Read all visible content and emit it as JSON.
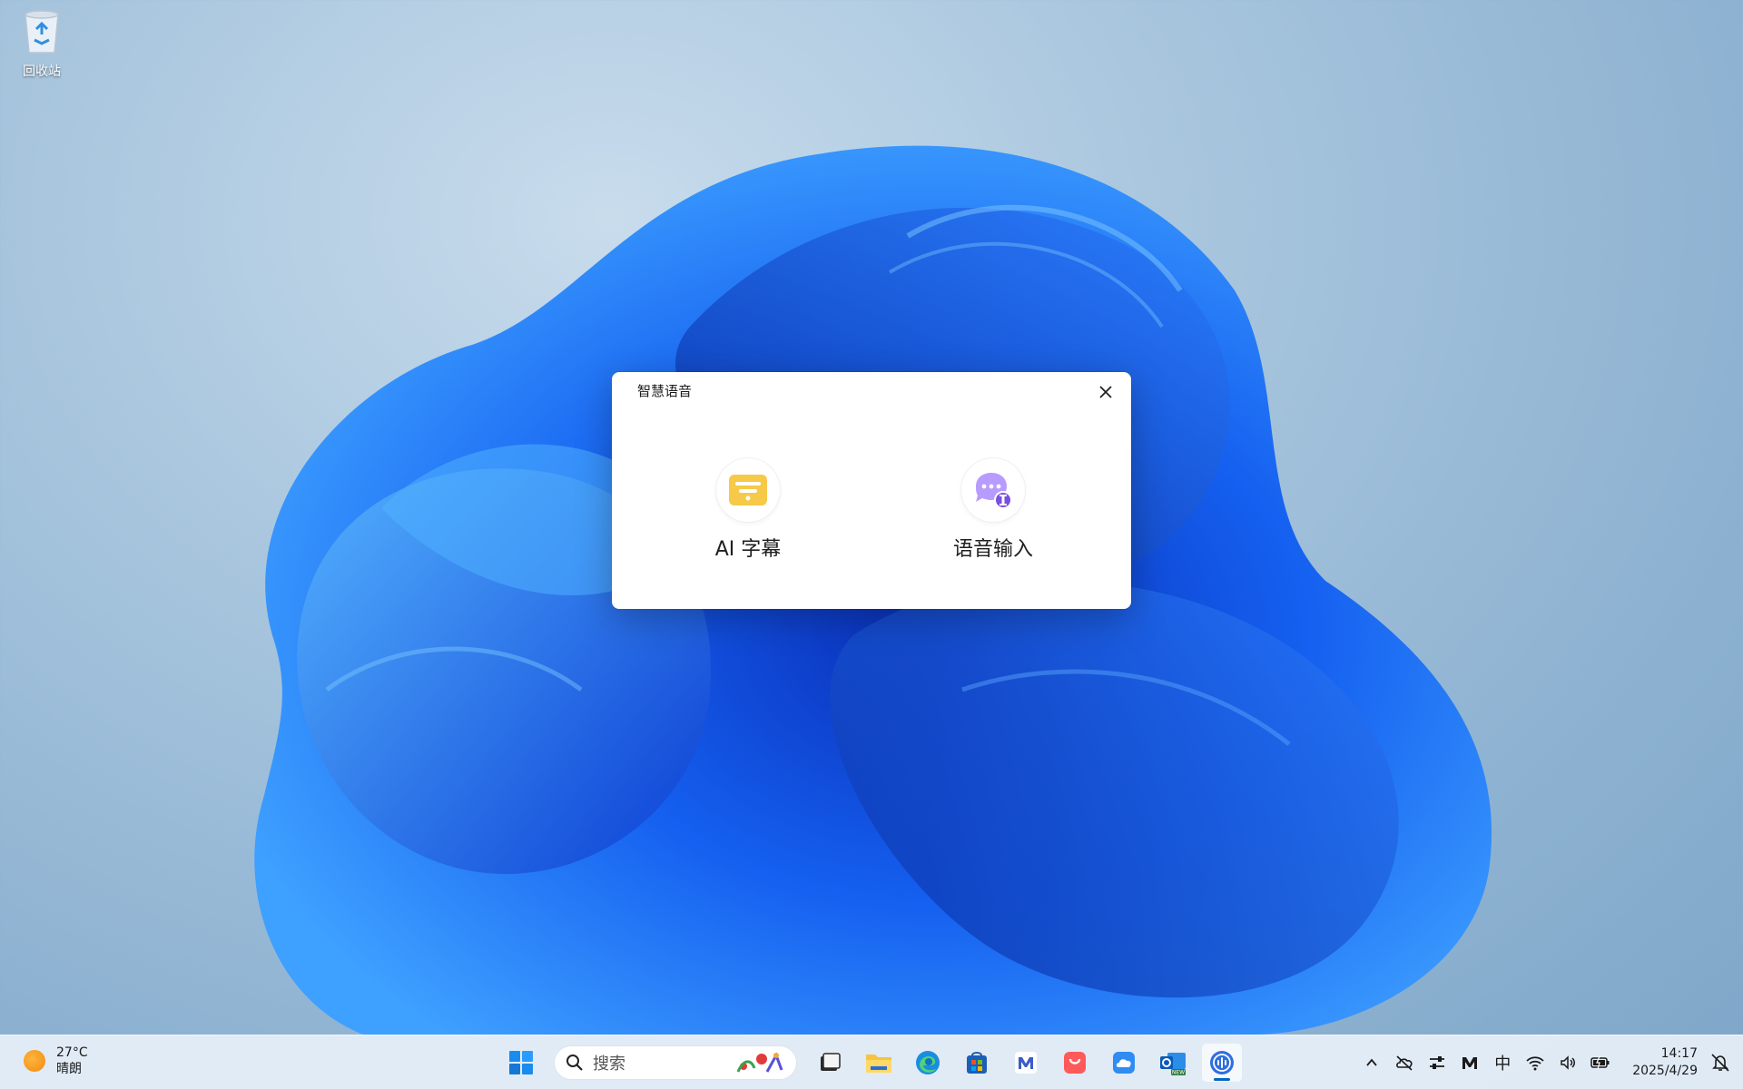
{
  "desktop": {
    "recycle_bin_label": "回收站"
  },
  "dialog": {
    "title": "智慧语音",
    "features": [
      {
        "label": "AI 字幕",
        "icon": "ai-subtitle-icon",
        "color": "#f7c948"
      },
      {
        "label": "语音输入",
        "icon": "voice-input-icon",
        "color": "#a78bfa"
      }
    ]
  },
  "taskbar": {
    "weather": {
      "temp": "27°C",
      "condition": "晴朗"
    },
    "search_placeholder": "搜索",
    "apps": [
      "start-icon",
      "task-view-icon",
      "file-explorer-icon",
      "edge-icon",
      "store-icon",
      "mail-app-icon",
      "app-store-icon",
      "cloud-icon",
      "outlook-new-icon",
      "smart-voice-icon"
    ],
    "tray": {
      "ime": "中",
      "time": "14:17",
      "date": "2025/4/29"
    }
  }
}
